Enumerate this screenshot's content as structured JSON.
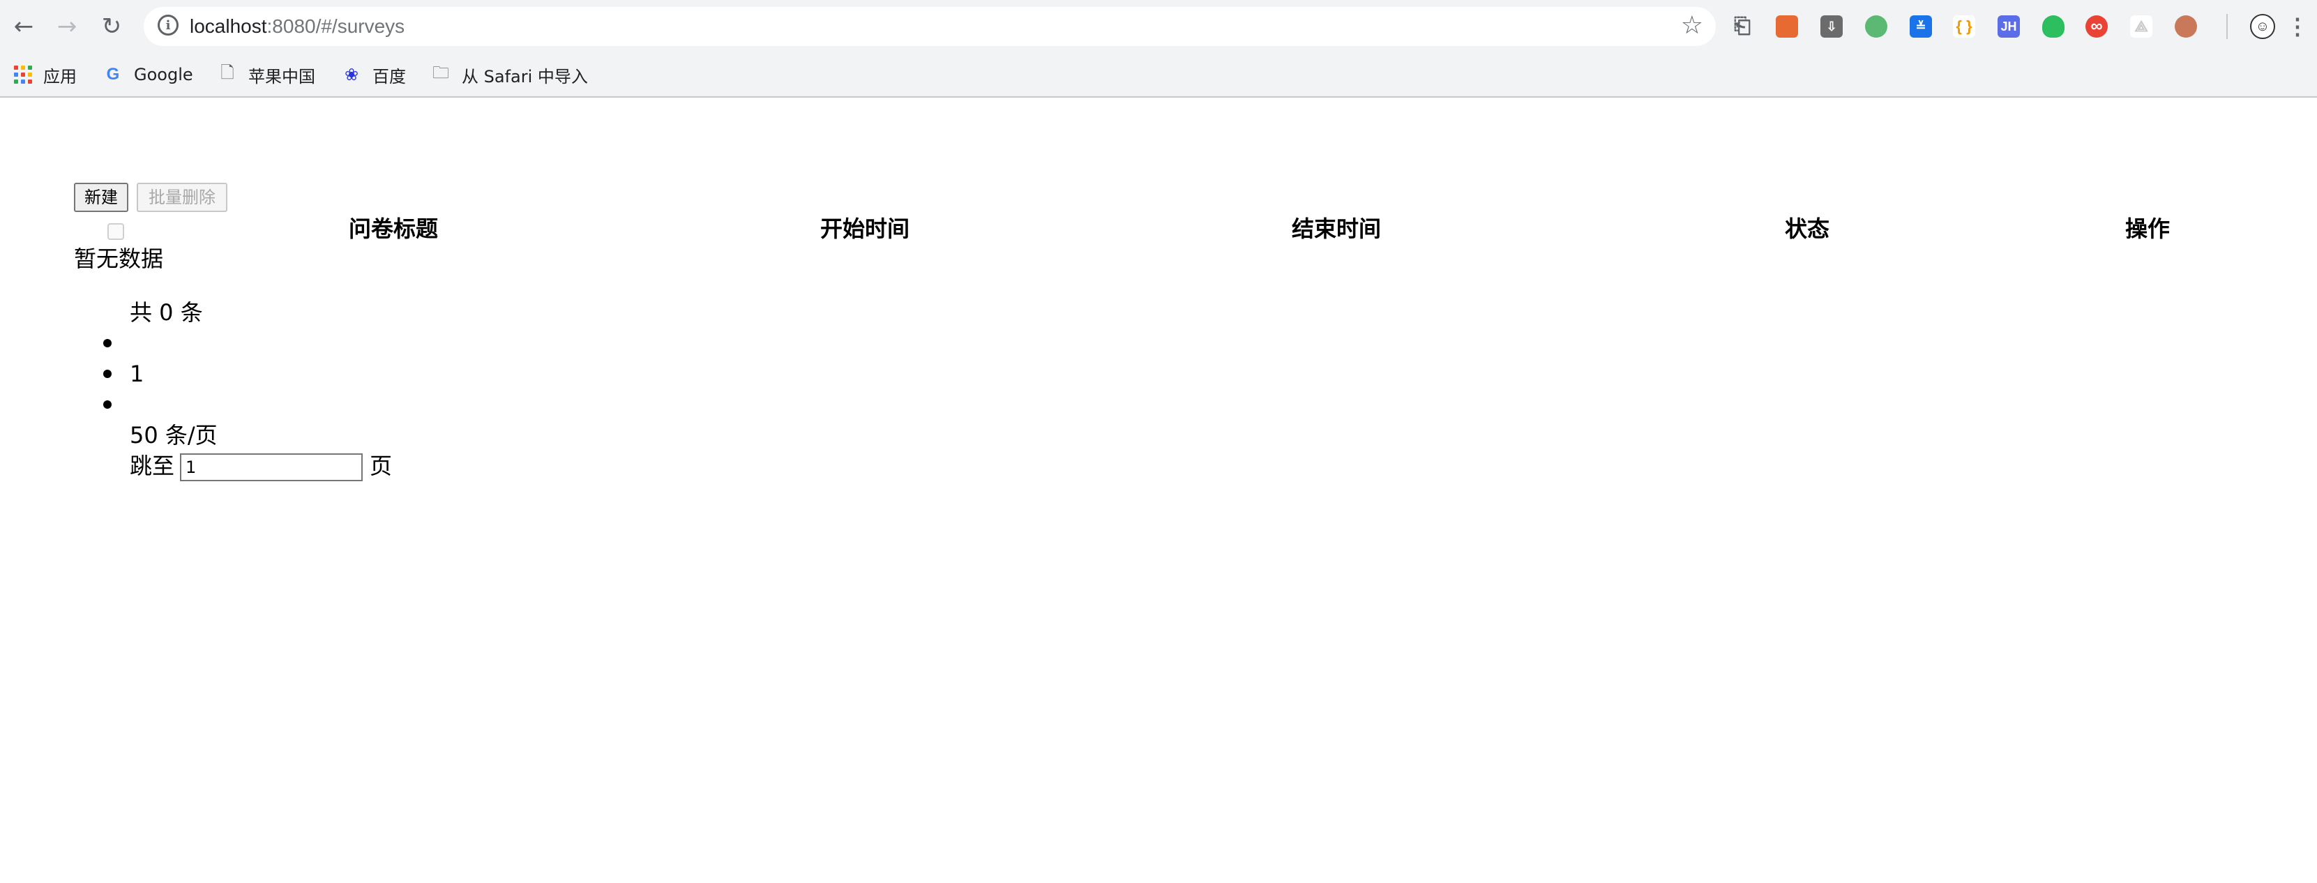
{
  "browser": {
    "url_host": "localhost",
    "url_rest": ":8080/#/surveys",
    "bookmarks": [
      "应用",
      "Google",
      "苹果中国",
      "百度",
      "从 Safari 中导入"
    ],
    "extensions": [
      {
        "label": "",
        "color": "#e86a33"
      },
      {
        "label": "",
        "color": "#6b6b6b"
      },
      {
        "label": "",
        "color": "#5bb974"
      },
      {
        "label": "",
        "color": "#1a73e8"
      },
      {
        "label": "{ }",
        "color": "#ffffff"
      },
      {
        "label": "JH",
        "color": "#5b6ee8"
      },
      {
        "label": "",
        "color": "#2dbe60"
      },
      {
        "label": "∞",
        "color": "#ea4335"
      },
      {
        "label": "",
        "color": "#ffffff"
      },
      {
        "label": "",
        "color": "#c9785a"
      }
    ]
  },
  "toolbar": {
    "new_label": "新建",
    "batch_delete_label": "批量删除"
  },
  "table": {
    "columns": [
      "问卷标题",
      "开始时间",
      "结束时间",
      "状态",
      "操作"
    ],
    "empty_text": "暂无数据"
  },
  "pagination": {
    "total_text": "共 0 条",
    "current_page": "1",
    "page_size_text": "50 条/页",
    "jump_prefix": "跳至",
    "jump_value": "1",
    "jump_suffix": "页"
  },
  "colors": {
    "chrome_bg": "#f1f3f4",
    "disabled_text": "#a8a8a8"
  }
}
